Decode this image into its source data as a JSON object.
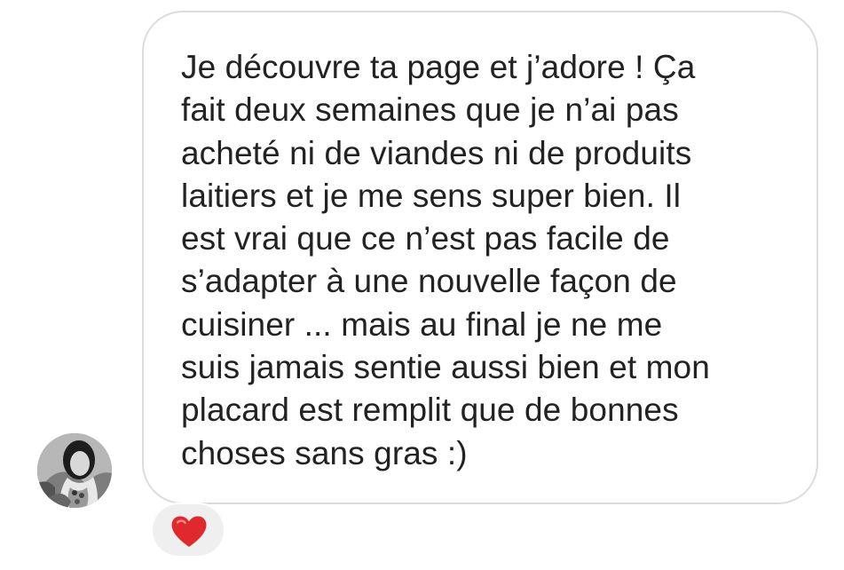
{
  "message": {
    "lines": [
      "Je découvre ta page et j’adore ! Ça",
      "fait deux semaines que je n’ai pas",
      "acheté ni de viandes ni de produits",
      "laitiers et je me sens super bien. Il",
      "est vrai que ce n’est pas facile de",
      "s’adapter à une nouvelle façon de",
      "cuisiner ... mais au final je ne me",
      "suis jamais sentie aussi bien et mon",
      "placard est remplit que de bonnes",
      "choses sans gras :)"
    ]
  },
  "sender": {
    "avatar_icon": "profile-photo"
  },
  "reaction": {
    "icon": "heart-icon",
    "color": "#e0282e"
  },
  "colors": {
    "bubble_border": "#dcdcdc",
    "text": "#222222",
    "reaction_background": "#efefef"
  }
}
